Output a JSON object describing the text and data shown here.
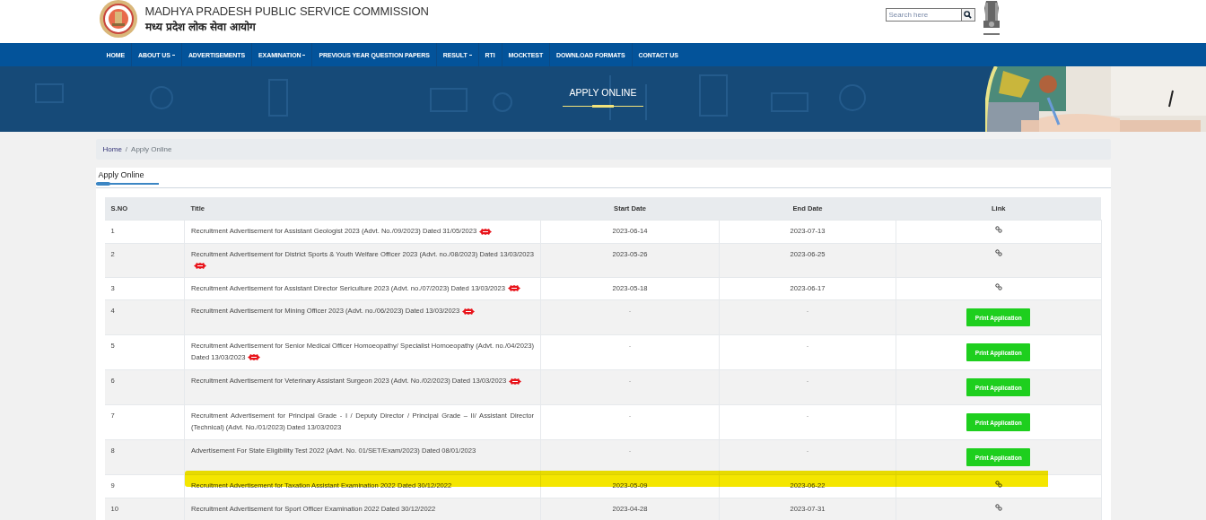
{
  "header": {
    "title": "MADHYA PRADESH PUBLIC SERVICE COMMISSION",
    "subtitle": "मध्य प्रदेश लोक सेवा आयोग"
  },
  "search": {
    "placeholder": "Search here"
  },
  "nav": [
    {
      "label": "HOME",
      "dropdown": false
    },
    {
      "label": "ABOUT US",
      "dropdown": true
    },
    {
      "label": "ADVERTISEMENTS",
      "dropdown": false
    },
    {
      "label": "EXAMINATION",
      "dropdown": true
    },
    {
      "label": "PREVIOUS YEAR QUESTION PAPERS",
      "dropdown": false
    },
    {
      "label": "RESULT",
      "dropdown": true
    },
    {
      "label": "RTI",
      "dropdown": false
    },
    {
      "label": "MOCKTEST",
      "dropdown": false
    },
    {
      "label": "DOWNLOAD FORMATS",
      "dropdown": false
    },
    {
      "label": "CONTACT US",
      "dropdown": false
    }
  ],
  "banner": {
    "title": "APPLY ONLINE"
  },
  "breadcrumb": [
    {
      "label": "Home",
      "link": true
    },
    {
      "separator": "/",
      "label": "Apply Online",
      "link": false
    }
  ],
  "tabs": [
    {
      "label": "Apply Online",
      "selected": true
    }
  ],
  "table": {
    "columns": [
      "S.NO",
      "Title",
      "Start Date",
      "End Date",
      "Link"
    ],
    "rows": [
      {
        "sno": "1",
        "title": "Recruitment Advertisement for Assistant Geologist 2023 (Advt. No./09/2023) Dated 31/05/2023",
        "new": true,
        "start": "2023-06-14",
        "end": "2023-07-13",
        "link": {
          "kind": "link"
        },
        "highlighted": false
      },
      {
        "sno": "2",
        "title": "Recruitment Advertisement for District Sports & Youth Welfare Officer 2023 (Advt. no./08/2023) Dated 13/03/2023",
        "new": true,
        "start": "2023-05-26",
        "end": "2023-06-25",
        "link": {
          "kind": "link"
        },
        "highlighted": false
      },
      {
        "sno": "3",
        "title": "Recruitment Advertisement for Assistant Director Sericulture 2023 (Advt. no./07/2023) Dated 13/03/2023",
        "new": true,
        "start": "2023-05-18",
        "end": "2023-06-17",
        "link": {
          "kind": "link"
        },
        "highlighted": false
      },
      {
        "sno": "4",
        "title": "Recruitment Advertisement for Mining Officer 2023 (Advt. no./06/2023) Dated 13/03/2023",
        "new": true,
        "start": "-",
        "end": "-",
        "link": {
          "kind": "button",
          "label": "Print Application"
        },
        "highlighted": false
      },
      {
        "sno": "5",
        "title": "Recruitment Advertisement for Senior Medical Officer Homoeopathy/ Specialist Homoeopathy (Advt. no./04/2023) Dated 13/03/2023",
        "new": true,
        "start": "-",
        "end": "-",
        "link": {
          "kind": "button",
          "label": "Print Application"
        },
        "highlighted": false
      },
      {
        "sno": "6",
        "title": "Recruitment Advertisement for Veterinary Assistant Surgeon 2023 (Advt. No./02/2023) Dated 13/03/2023",
        "new": true,
        "start": "-",
        "end": "-",
        "link": {
          "kind": "button",
          "label": "Print Application"
        },
        "highlighted": false
      },
      {
        "sno": "7",
        "title": "Recruitment Advertisement for Principal Grade - I / Deputy Director / Principal Grade – II/ Assistant Director (Technical) (Advt. No./01/2023) Dated 13/03/2023",
        "new": false,
        "start": "-",
        "end": "-",
        "link": {
          "kind": "button",
          "label": "Print Application"
        },
        "highlighted": false
      },
      {
        "sno": "8",
        "title": "Advertisement For State Eligibility Test 2022 (Advt. No. 01/SET/Exam/2023) Dated 08/01/2023",
        "new": false,
        "start": "-",
        "end": "-",
        "link": {
          "kind": "button",
          "label": "Print Application"
        },
        "highlighted": false
      },
      {
        "sno": "9",
        "title": "Recruitment Advertisement for Taxation Assistant Examination 2022 Dated 30/12/2022",
        "new": false,
        "start": "2023-05-09",
        "end": "2023-06-22",
        "link": {
          "kind": "link"
        },
        "highlighted": true
      },
      {
        "sno": "10",
        "title": "Recruitment Advertisement for Sport Officer Examination 2022 Dated 30/12/2022",
        "new": false,
        "start": "2023-04-28",
        "end": "2023-07-31",
        "link": {
          "kind": "link"
        },
        "highlighted": false
      }
    ]
  }
}
